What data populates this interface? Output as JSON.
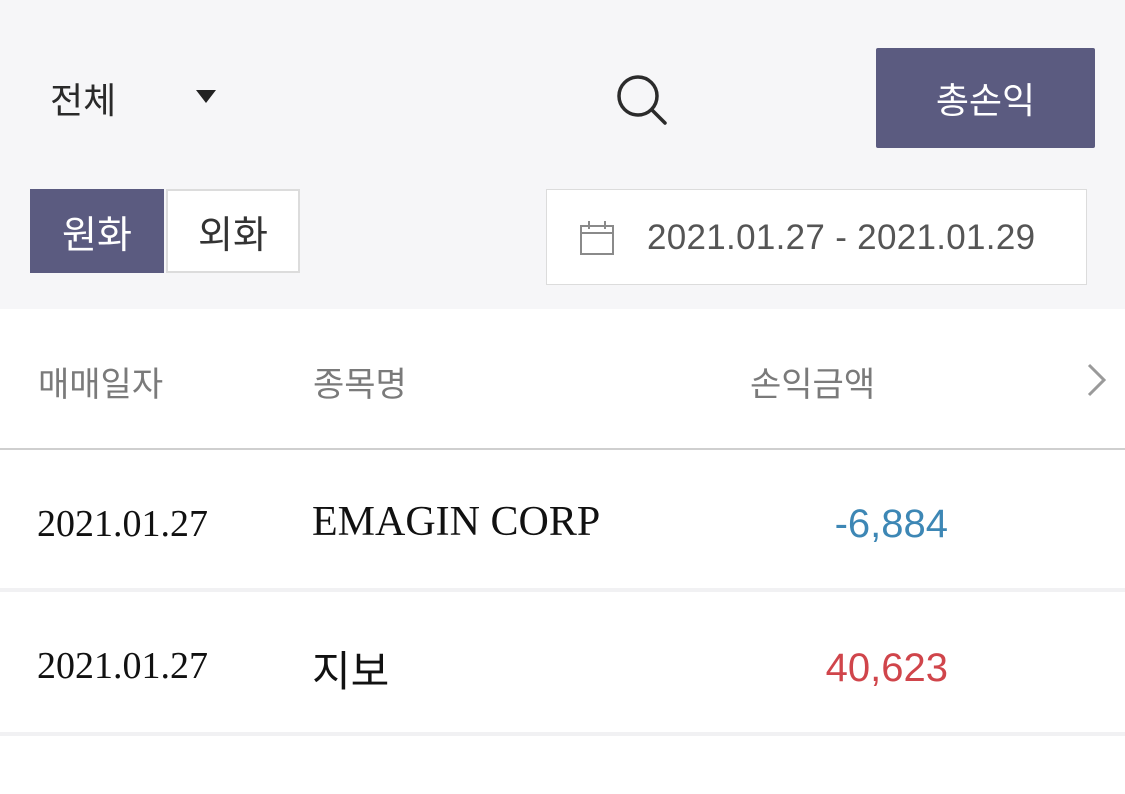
{
  "filters": {
    "category": "전체",
    "total_button": "총손익",
    "currency": {
      "krw_label": "원화",
      "foreign_label": "외화",
      "selected": "원화"
    },
    "date_range": "2021.01.27 - 2021.01.29"
  },
  "table": {
    "headers": {
      "trade_date": "매매일자",
      "stock_name": "종목명",
      "profit_amount": "손익금액"
    },
    "rows": [
      {
        "trade_date": "2021.01.27",
        "stock_name": "EMAGIN CORP",
        "profit_amount": "-6,884",
        "amount_color": "#3d87b5"
      },
      {
        "trade_date": "2021.01.27",
        "stock_name": "지보",
        "profit_amount": "40,623",
        "amount_color": "#d0454b"
      }
    ]
  },
  "colors": {
    "accent": "#5b5b80",
    "panel_background": "#f6f6f8",
    "loss": "#3d87b5",
    "profit": "#d0454b"
  },
  "icons": {
    "dropdown": "caret-down-icon",
    "search": "search-icon",
    "calendar": "calendar-icon",
    "next_column": "chevron-right-icon"
  }
}
